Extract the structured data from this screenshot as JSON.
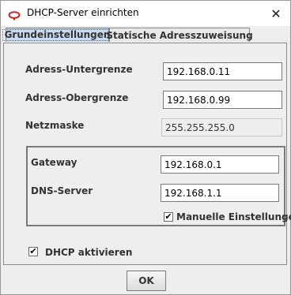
{
  "window": {
    "title": "DHCP-Server einrichten",
    "close_symbol": "✕",
    "app_icon": "link-icon"
  },
  "tabs": [
    {
      "label": "Grundeinstellungen",
      "selected": true
    },
    {
      "label": "Statische Adresszuweisung",
      "selected": false
    }
  ],
  "form": {
    "lower_limit_label": "Adress-Untergrenze",
    "lower_limit_value": "192.168.0.11",
    "upper_limit_label": "Adress-Obergrenze",
    "upper_limit_value": "192.168.0.99",
    "netmask_label": "Netzmaske",
    "netmask_value": "255.255.255.0"
  },
  "group": {
    "gateway_label": "Gateway",
    "gateway_value": "192.168.0.1",
    "dns_label": "DNS-Server",
    "dns_value": "192.168.1.1",
    "manual_label": "Manuelle Einstellungen",
    "manual_checked": true
  },
  "dhcp": {
    "label": "DHCP aktivieren",
    "checked": true
  },
  "buttons": {
    "ok_label": "OK"
  },
  "check_mark": "✔"
}
